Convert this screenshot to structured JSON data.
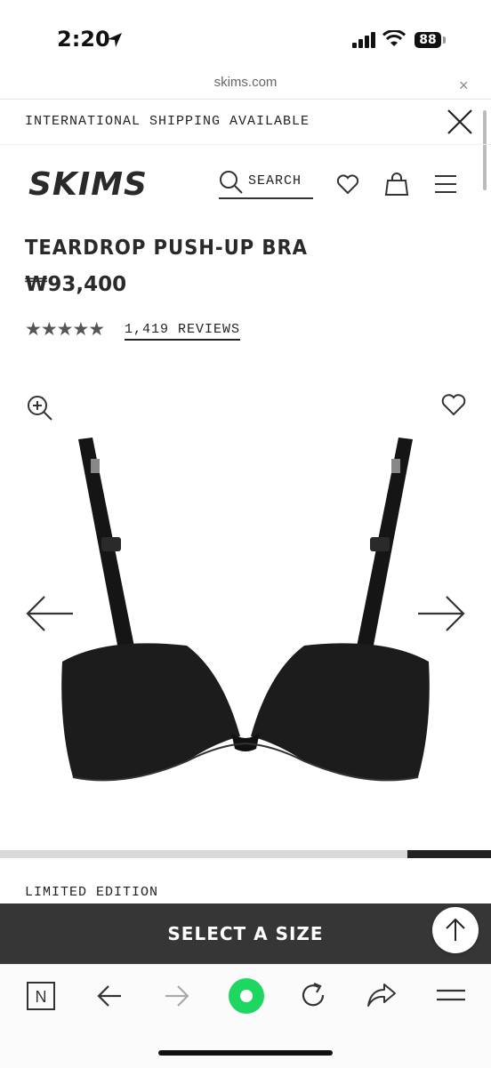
{
  "status_bar": {
    "time": "2:20",
    "battery": "88"
  },
  "browser": {
    "url": "skims.com",
    "close_glyph": "×"
  },
  "banner": {
    "text": "INTERNATIONAL SHIPPING AVAILABLE"
  },
  "header": {
    "brand": "SKIMS",
    "search_label": "SEARCH"
  },
  "product": {
    "title": "TEARDROP PUSH-UP BRA",
    "price": "₩93,400",
    "rating": 4.7,
    "stars": "★★★★★",
    "reviews_label": "1,419 REVIEWS",
    "gallery_progress": 0.17,
    "badge": "LIMITED EDITION"
  },
  "cta": {
    "label": "SELECT A SIZE"
  },
  "toolbar": {
    "home_letter": "N"
  },
  "colors": {
    "cta_bg": "#363636",
    "accent_green": "#1ed760",
    "text": "#222222"
  }
}
